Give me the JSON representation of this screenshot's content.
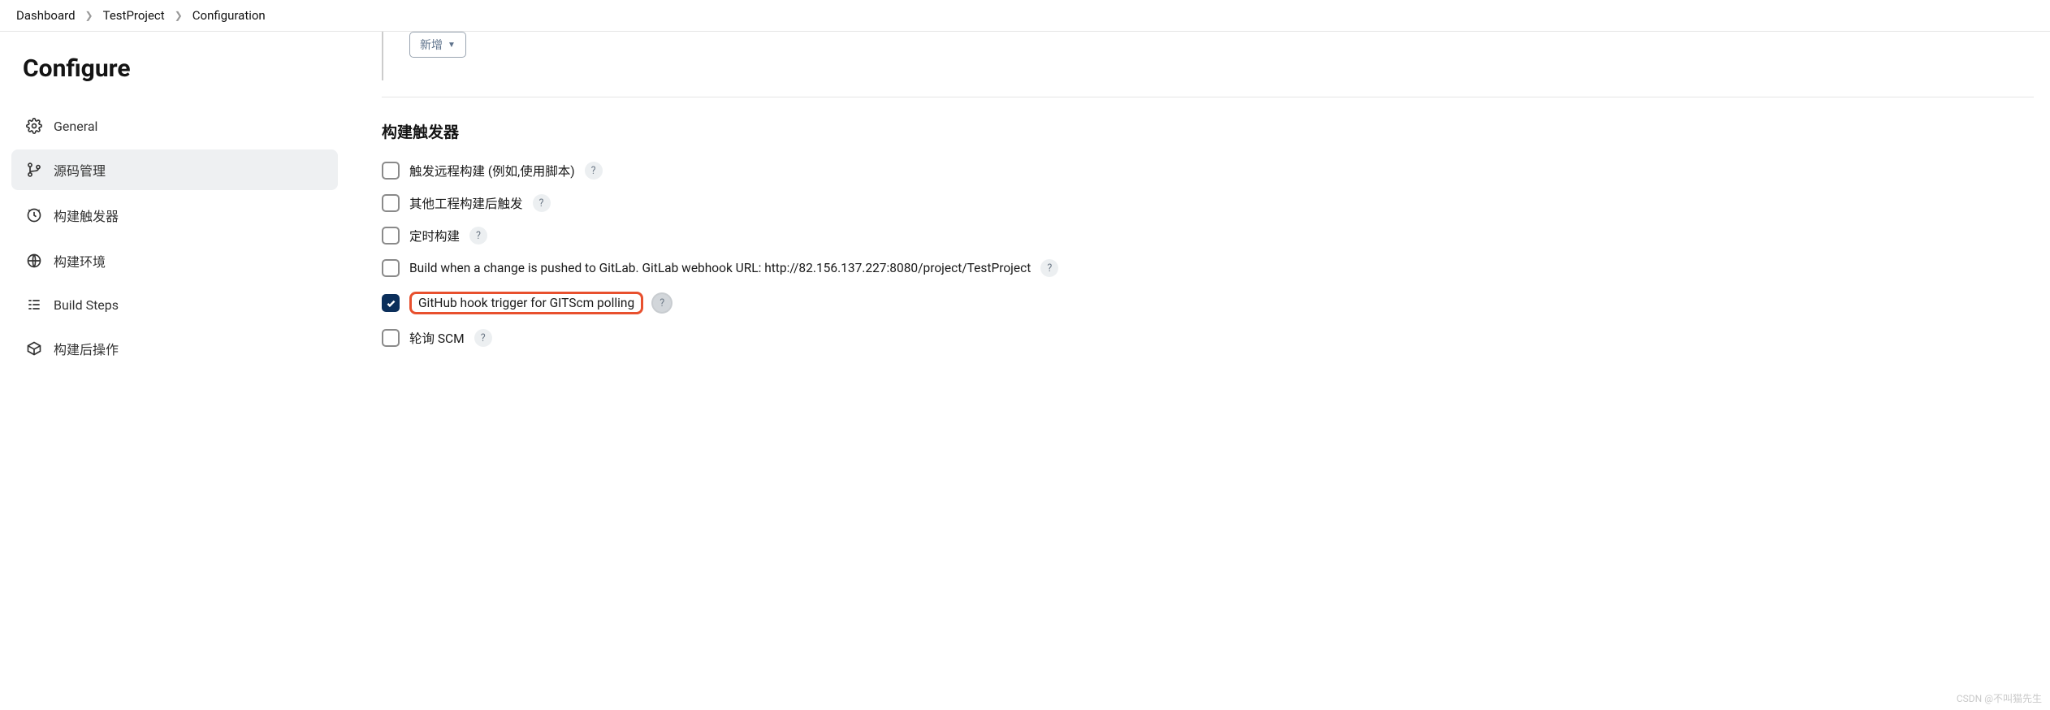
{
  "breadcrumb": {
    "items": [
      "Dashboard",
      "TestProject",
      "Configuration"
    ]
  },
  "page_title": "Configure",
  "sidebar": {
    "items": [
      {
        "label": "General",
        "icon": "gear-icon",
        "active": false
      },
      {
        "label": "源码管理",
        "icon": "branch-icon",
        "active": true
      },
      {
        "label": "构建触发器",
        "icon": "clock-icon",
        "active": false
      },
      {
        "label": "构建环境",
        "icon": "globe-icon",
        "active": false
      },
      {
        "label": "Build Steps",
        "icon": "steps-icon",
        "active": false
      },
      {
        "label": "构建后操作",
        "icon": "box-icon",
        "active": false
      }
    ]
  },
  "add_button": {
    "label": "新增"
  },
  "section": {
    "title": "构建触发器",
    "options": [
      {
        "label": "触发远程构建 (例如,使用脚本)",
        "checked": false,
        "help": true,
        "highlight": false
      },
      {
        "label": "其他工程构建后触发",
        "checked": false,
        "help": true,
        "highlight": false
      },
      {
        "label": "定时构建",
        "checked": false,
        "help": true,
        "highlight": false
      },
      {
        "label": "Build when a change is pushed to GitLab. GitLab webhook URL: http://82.156.137.227:8080/project/TestProject",
        "checked": false,
        "help": true,
        "highlight": false
      },
      {
        "label": "GitHub hook trigger for GITScm polling",
        "checked": true,
        "help": true,
        "highlight": true,
        "help_focused": true
      },
      {
        "label": "轮询 SCM",
        "checked": false,
        "help": true,
        "highlight": false
      }
    ]
  },
  "help_glyph": "?",
  "watermark": "CSDN @不叫猫先生"
}
